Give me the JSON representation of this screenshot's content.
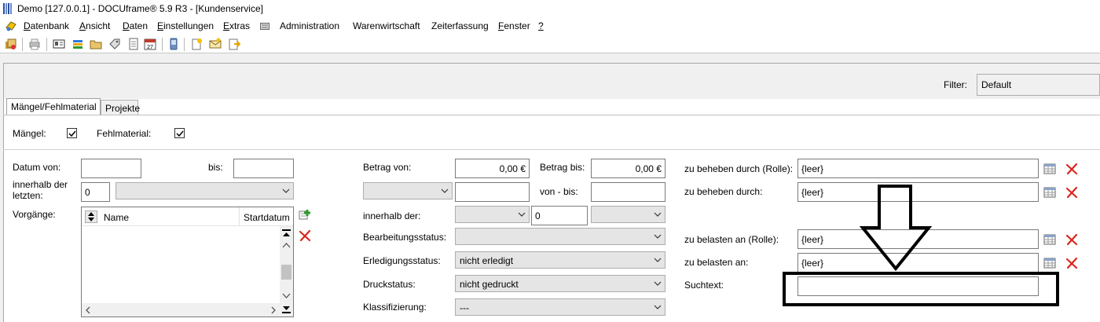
{
  "window": {
    "title": "Demo [127.0.0.1] - DOCUframe® 5.9 R3 - [Kundenservice]"
  },
  "menu": [
    {
      "ul": "D",
      "rest": "atenbank"
    },
    {
      "ul": "A",
      "rest": "nsicht"
    },
    {
      "ul": "D",
      "rest": "aten"
    },
    {
      "ul": "E",
      "rest": "instellungen"
    },
    {
      "ul": "E",
      "rest": "xtras"
    },
    {
      "ul": "",
      "rest": "Administration"
    },
    {
      "ul": "",
      "rest": "Warenwirtschaft"
    },
    {
      "ul": "",
      "rest": "Zeiterfassung"
    },
    {
      "ul": "F",
      "rest": "enster"
    },
    {
      "ul": "?",
      "rest": ""
    }
  ],
  "filter": {
    "label": "Filter:",
    "value": "Default"
  },
  "tabs": [
    "Mängel/Fehlmaterial",
    "Projekte"
  ],
  "checks": {
    "maengel": "Mängel:",
    "fehlmaterial": "Fehlmaterial:"
  },
  "left": {
    "datum_von": "Datum von:",
    "bis": "bis:",
    "innerhalb_1": "innerhalb der",
    "innerhalb_2": "letzten:",
    "innerhalb_value": "0",
    "vorgaenge": "Vorgänge:",
    "list_columns": {
      "name": "Name",
      "startdatum": "Startdatum"
    }
  },
  "middle": {
    "betrag_von": "Betrag von:",
    "betrag_von_value": "0,00 €",
    "betrag_bis": "Betrag bis:",
    "betrag_bis_value": "0,00 €",
    "von_bis": "von - bis:",
    "innerhalb_der": "innerhalb der:",
    "innerhalb_der_value": "0",
    "bearbeitungsstatus": "Bearbeitungsstatus:",
    "erledigungsstatus": "Erledigungsstatus:",
    "erledigungsstatus_value": "nicht erledigt",
    "druckstatus": "Druckstatus:",
    "druckstatus_value": "nicht gedruckt",
    "klassifizierung": "Klassifizierung:",
    "klassifizierung_value": "---"
  },
  "right": {
    "zu_beheben_rolle": "zu beheben durch (Rolle):",
    "zu_beheben_rolle_value": "{leer}",
    "zu_beheben": "zu beheben durch:",
    "zu_beheben_value": "{leer}",
    "zu_belasten_rolle": "zu belasten an (Rolle):",
    "zu_belasten_rolle_value": "{leer}",
    "zu_belasten": "zu belasten an:",
    "zu_belasten_value": "{leer}",
    "suchtext": "Suchtext:",
    "suchtext_value": ""
  },
  "colors": {
    "red_x": "#d9261c",
    "green_plus": "#2e9a2e"
  }
}
